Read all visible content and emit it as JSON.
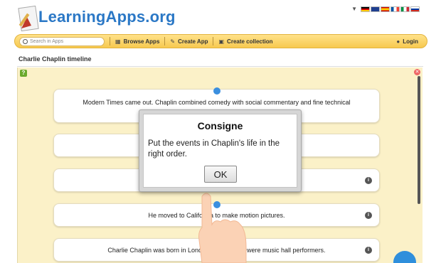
{
  "header": {
    "site_name": "LearningApps.org",
    "languages": [
      "de",
      "en",
      "es",
      "fr",
      "it",
      "ru"
    ]
  },
  "toolbar": {
    "search_placeholder": "Search in Apps",
    "browse_label": "Browse Apps",
    "create_app_label": "Create App",
    "create_collection_label": "Create collection",
    "login_label": "Login"
  },
  "page": {
    "title": "Charlie Chaplin timeline"
  },
  "cards": [
    {
      "text": "Modern Times came out. Chaplin combined comedy with social commentary and fine technical crafts-manship."
    },
    {
      "text": ""
    },
    {
      "text": ""
    },
    {
      "text": "He moved to California to make motion pictures."
    },
    {
      "text": "Charlie Chaplin was born in London. His parents were music hall performers."
    }
  ],
  "dialog": {
    "title": "Consigne",
    "text": "Put the events in Chaplin's life in the right order.",
    "ok_label": "OK"
  },
  "colors": {
    "brand_blue": "#2b78c6",
    "toolbar_yellow": "#f7c94f",
    "app_background": "#fbf1c8"
  }
}
